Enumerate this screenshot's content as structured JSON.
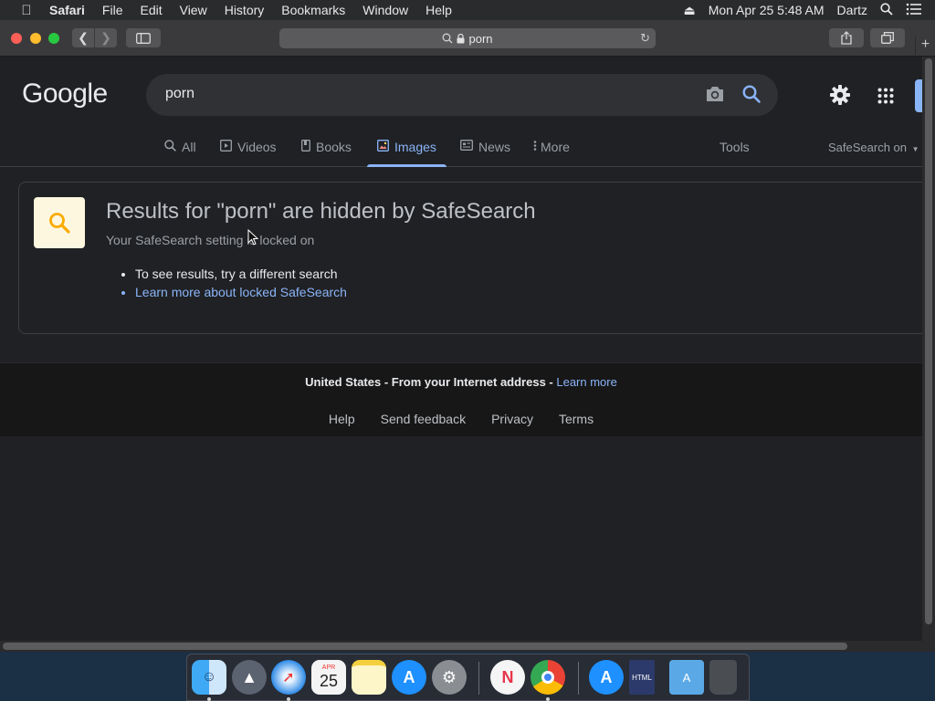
{
  "menubar": {
    "app": "Safari",
    "items": [
      "File",
      "Edit",
      "View",
      "History",
      "Bookmarks",
      "Window",
      "Help"
    ],
    "clock": "Mon Apr 25  5:48 AM",
    "user": "Dartz"
  },
  "browser": {
    "address": "porn"
  },
  "google": {
    "logo": "Google",
    "query": "porn",
    "tabs": [
      {
        "label": "All",
        "icon": "search-icon"
      },
      {
        "label": "Videos",
        "icon": "play-icon"
      },
      {
        "label": "Books",
        "icon": "book-icon"
      },
      {
        "label": "Images",
        "icon": "image-icon",
        "active": true
      },
      {
        "label": "News",
        "icon": "news-icon"
      },
      {
        "label": "More",
        "icon": "more-vertical-icon"
      }
    ],
    "tools": "Tools",
    "safesearch": "SafeSearch on"
  },
  "notice": {
    "title": "Results for \"porn\" are hidden by SafeSearch",
    "subtitle": "Your SafeSearch setting is locked on",
    "bullet1": "To see results, try a different search",
    "bullet2": "Learn more about locked SafeSearch"
  },
  "footer": {
    "location": "United States - From your Internet address - ",
    "learn_more": "Learn more",
    "links": [
      "Help",
      "Send feedback",
      "Privacy",
      "Terms"
    ]
  },
  "dock": {
    "calendar_day": "25",
    "calendar_month": "APR"
  },
  "colors": {
    "accent": "#8ab4f8",
    "page_bg": "#202124",
    "text": "#e8eaed"
  }
}
